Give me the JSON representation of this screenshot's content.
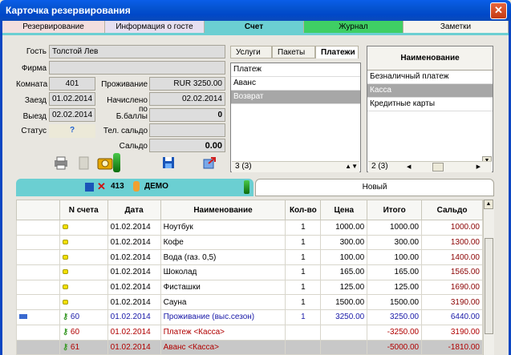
{
  "window": {
    "title": "Карточка резервирования",
    "close": "✕"
  },
  "tabs": [
    {
      "label": "Резервирование",
      "color": "#f3dede"
    },
    {
      "label": "Информация о госте",
      "color": "#e6dff0"
    },
    {
      "label": "Счет",
      "color": "#6bcfd2"
    },
    {
      "label": "Журнал",
      "color": "#3fcf64"
    },
    {
      "label": "Заметки",
      "color": "#f5f4ee"
    }
  ],
  "guest": {
    "guest_label": "Гость",
    "guest_value": "Толстой Лев",
    "firm_label": "Фирма",
    "firm_value": "",
    "room_label": "Комната",
    "room_value": "401",
    "checkin_label": "Заезд",
    "checkin_value": "01.02.2014",
    "checkout_label": "Выезд",
    "checkout_value": "02.02.2014",
    "status_label": "Статус",
    "status_value": "?",
    "stay_label": "Проживание",
    "stay_value": "RUR 3250.00",
    "accrued_label": "Начислено по",
    "accrued_value": "02.02.2014",
    "bonus_label": "Б.баллы",
    "bonus_value": "0",
    "phone_label": "Тел. сальдо",
    "phone_value": "",
    "saldo_label": "Сальдо",
    "saldo_value": "0.00"
  },
  "payments": {
    "tabs": [
      "Услуги",
      "Пакеты",
      "Платежи"
    ],
    "active_tab": "Платежи",
    "rows": [
      "Платеж",
      "Аванс",
      "Возврат"
    ],
    "selected": "Возврат",
    "counter": "3 (3)"
  },
  "names": {
    "header": "Наименование",
    "rows": [
      "Безналичный платеж",
      "Касса",
      "Кредитные карты"
    ],
    "selected": "Касса",
    "counter": "2 (3)"
  },
  "account": {
    "room": "413",
    "name": "ДЕМО",
    "new_tab": "Новый"
  },
  "grid": {
    "headers": [
      "N счета",
      "Дата",
      "Наименование",
      "Кол-во",
      "Цена",
      "Итого",
      "Сальдо"
    ],
    "rows": [
      {
        "acct": "",
        "date": "01.02.2014",
        "name": "Ноутбук",
        "qty": "1",
        "price": "1000.00",
        "total": "1000.00",
        "saldo": "1000.00",
        "style": ""
      },
      {
        "acct": "",
        "date": "01.02.2014",
        "name": "Кофе",
        "qty": "1",
        "price": "300.00",
        "total": "300.00",
        "saldo": "1300.00",
        "style": ""
      },
      {
        "acct": "",
        "date": "01.02.2014",
        "name": "Вода (газ. 0,5)",
        "qty": "1",
        "price": "100.00",
        "total": "100.00",
        "saldo": "1400.00",
        "style": ""
      },
      {
        "acct": "",
        "date": "01.02.2014",
        "name": "Шоколад",
        "qty": "1",
        "price": "165.00",
        "total": "165.00",
        "saldo": "1565.00",
        "style": ""
      },
      {
        "acct": "",
        "date": "01.02.2014",
        "name": "Фисташки",
        "qty": "1",
        "price": "125.00",
        "total": "125.00",
        "saldo": "1690.00",
        "style": ""
      },
      {
        "acct": "",
        "date": "01.02.2014",
        "name": "Сауна",
        "qty": "1",
        "price": "1500.00",
        "total": "1500.00",
        "saldo": "3190.00",
        "style": ""
      },
      {
        "acct": "60",
        "date": "01.02.2014",
        "name": "Проживание (выс.сезон)",
        "qty": "1",
        "price": "3250.00",
        "total": "3250.00",
        "saldo": "6440.00",
        "style": "blue"
      },
      {
        "acct": "60",
        "date": "01.02.2014",
        "name": "Платеж <Касса>",
        "qty": "",
        "price": "",
        "total": "-3250.00",
        "saldo": "3190.00",
        "style": "red"
      },
      {
        "acct": "61",
        "date": "01.02.2014",
        "name": "Аванс <Касса>",
        "qty": "",
        "price": "",
        "total": "-5000.00",
        "saldo": "-1810.00",
        "style": "last"
      }
    ]
  }
}
